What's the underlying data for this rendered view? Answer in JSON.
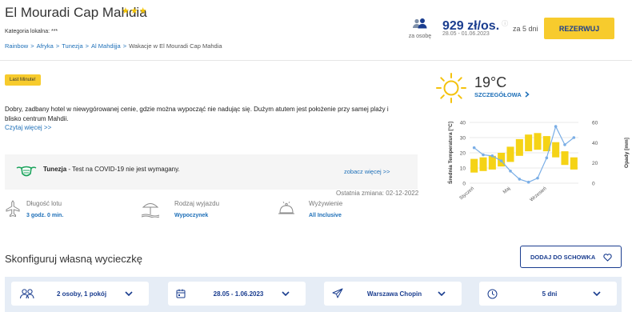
{
  "hotel": {
    "name": "El Mouradi Cap Mahdia",
    "stars": "★★★",
    "category": "Kategoria lokalna: ***"
  },
  "breadcrumb": {
    "items": [
      "Rainbow",
      "Afryka",
      "Tunezja",
      "Al Mahdijja"
    ],
    "current": "Wakacje w El Mouradi Cap Mahdia",
    "separator": ">"
  },
  "booking": {
    "persons_label": "za osobę",
    "price": "929 zł/os.",
    "info_icon": "ⓘ",
    "dates": "28.05 - 01.06.2023",
    "days": "za 5 dni",
    "button": "REZERWUJ"
  },
  "badge": "Last Minute!",
  "description": {
    "text": "Dobry, zadbany hotel w niewygórowanej cenie, gdzie można wypocząć nie nadując się. Dużym atutem jest położenie przy samej plaży i blisko centrum Mahdii.",
    "more": "Czytaj więcej >>"
  },
  "covid": {
    "country": "Tunezja",
    "text": " - Test na COVID-19 nie jest wymagany.",
    "link": "zobacz więcej >>"
  },
  "last_change": "Ostatnia zmiana: 02-12-2022",
  "features": [
    {
      "label": "Długość lotu",
      "value": "3 godz. 0 min.",
      "icon": "airplane-icon"
    },
    {
      "label": "Rodzaj wyjazdu",
      "value": "Wypoczynek",
      "icon": "beach-umbrella-icon"
    },
    {
      "label": "Wyżywienie",
      "value": "All Inclusive",
      "icon": "cloche-icon"
    }
  ],
  "weather": {
    "temperature": "19°C",
    "details_link": "SZCZEGÓŁOWA"
  },
  "chart_data": {
    "type": "bar",
    "ylabel": "Średnia Temperatura [°C]",
    "y2label": "Opady [mm]",
    "ylim": [
      0,
      40
    ],
    "y2lim": [
      0,
      60
    ],
    "yticks": [
      "0",
      "10",
      "20",
      "30",
      "40"
    ],
    "y2ticks": [
      "0",
      "20",
      "40",
      "60"
    ],
    "x_labels": [
      "Styczeń",
      "Maj",
      "Wrzesień"
    ],
    "temperature_ranges": [
      [
        7,
        16
      ],
      [
        8,
        17
      ],
      [
        9,
        18
      ],
      [
        11,
        20
      ],
      [
        14,
        24
      ],
      [
        18,
        29
      ],
      [
        21,
        32
      ],
      [
        22,
        33
      ],
      [
        21,
        31
      ],
      [
        17,
        27
      ],
      [
        12,
        21
      ],
      [
        9,
        17
      ]
    ],
    "precipitation": [
      35,
      28,
      27,
      22,
      12,
      4,
      1,
      5,
      25,
      56,
      38,
      45
    ],
    "colors": {
      "bars": "#f5d316",
      "line": "#7aaee6"
    }
  },
  "configurator": {
    "title": "Skonfiguruj własną wycieczkę",
    "save_button": "DODAJ DO SCHOWKA",
    "travelers": "2 osoby, 1 pokój",
    "dates": "28.05 - 1.06.2023",
    "airport": "Warszawa Chopin",
    "duration": "5 dni"
  },
  "colors": {
    "accent": "#f7cb2d",
    "brand": "#1a3d8f",
    "link": "#1d6fb8"
  }
}
